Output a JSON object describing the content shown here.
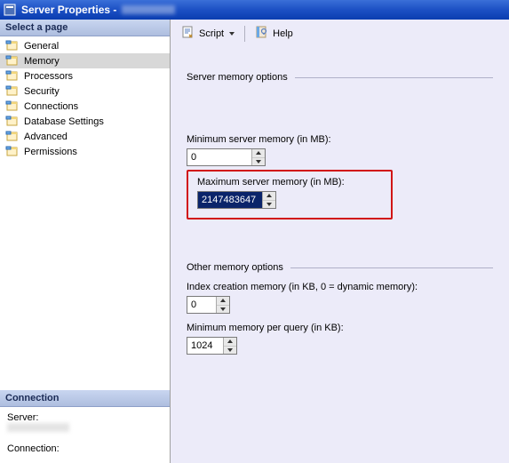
{
  "window": {
    "title_prefix": "Server Properties -"
  },
  "sidebar": {
    "select_page_header": "Select a page",
    "items": [
      {
        "label": "General"
      },
      {
        "label": "Memory"
      },
      {
        "label": "Processors"
      },
      {
        "label": "Security"
      },
      {
        "label": "Connections"
      },
      {
        "label": "Database Settings"
      },
      {
        "label": "Advanced"
      },
      {
        "label": "Permissions"
      }
    ],
    "selected_index": 1,
    "connection_header": "Connection",
    "connection": {
      "server_label": "Server:",
      "connection_label": "Connection:"
    }
  },
  "toolbar": {
    "script_label": "Script",
    "help_label": "Help"
  },
  "form": {
    "group1_title": "Server memory options",
    "min_mem_label": "Minimum server memory (in MB):",
    "min_mem_value": "0",
    "max_mem_label": "Maximum server memory (in MB):",
    "max_mem_value": "2147483647",
    "group2_title": "Other memory options",
    "index_mem_label": "Index creation memory (in KB, 0 = dynamic memory):",
    "index_mem_value": "0",
    "min_query_label": "Minimum memory per query (in KB):",
    "min_query_value": "1024"
  }
}
